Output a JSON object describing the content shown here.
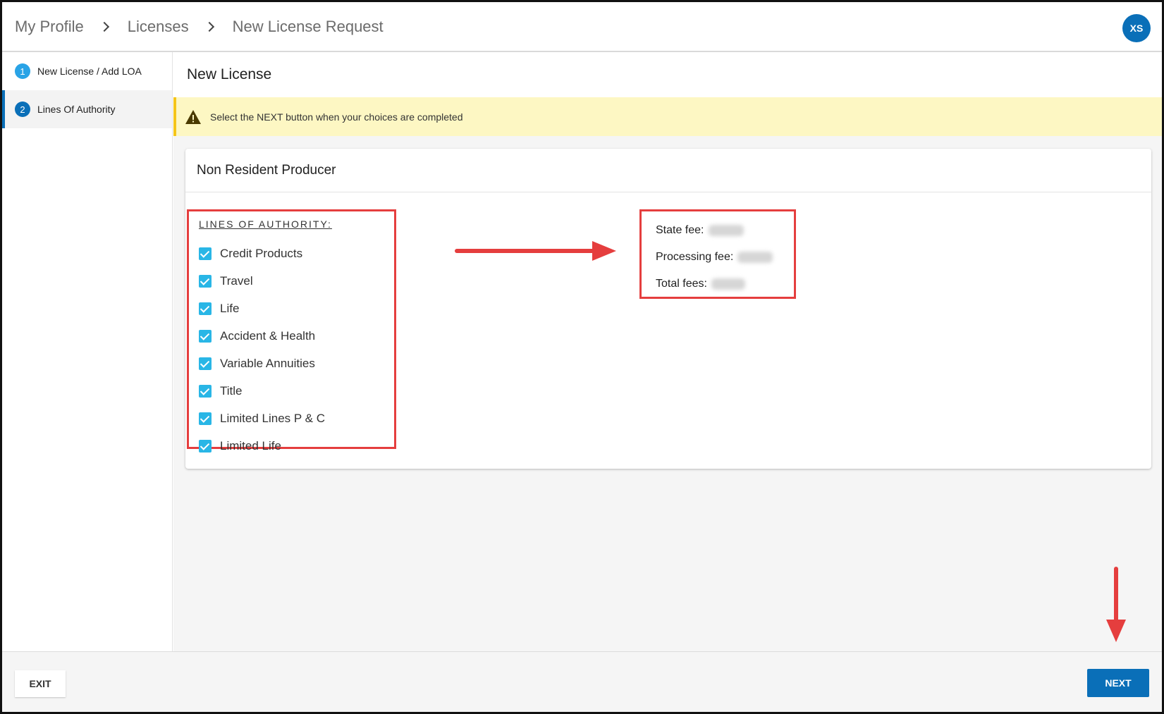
{
  "breadcrumb": [
    "My Profile",
    "Licenses",
    "New License Request"
  ],
  "user": {
    "initials": "XS"
  },
  "sidebar": {
    "steps": [
      {
        "number": "1",
        "label": "New License / Add LOA"
      },
      {
        "number": "2",
        "label": "Lines Of Authority"
      }
    ]
  },
  "main": {
    "title": "New License",
    "warning": "Select the NEXT button when your choices are completed",
    "card": {
      "title": "Non Resident Producer",
      "loa_heading": "LINES OF AUTHORITY:",
      "loa_items": [
        {
          "label": "Credit Products",
          "checked": true
        },
        {
          "label": "Travel",
          "checked": true
        },
        {
          "label": "Life",
          "checked": true
        },
        {
          "label": "Accident & Health",
          "checked": true
        },
        {
          "label": "Variable Annuities",
          "checked": true
        },
        {
          "label": "Title",
          "checked": true
        },
        {
          "label": "Limited Lines P & C",
          "checked": true
        },
        {
          "label": "Limited Life",
          "checked": true
        }
      ],
      "fees": {
        "state_fee_label": "State fee:",
        "processing_fee_label": "Processing fee:",
        "total_fees_label": "Total fees:"
      }
    }
  },
  "footer": {
    "exit_label": "EXIT",
    "next_label": "NEXT"
  },
  "colors": {
    "primary": "#0a6fb8",
    "checkbox": "#29b6e6",
    "annotation_red": "#e53e3e",
    "warning_bg": "#fdf7c3"
  }
}
